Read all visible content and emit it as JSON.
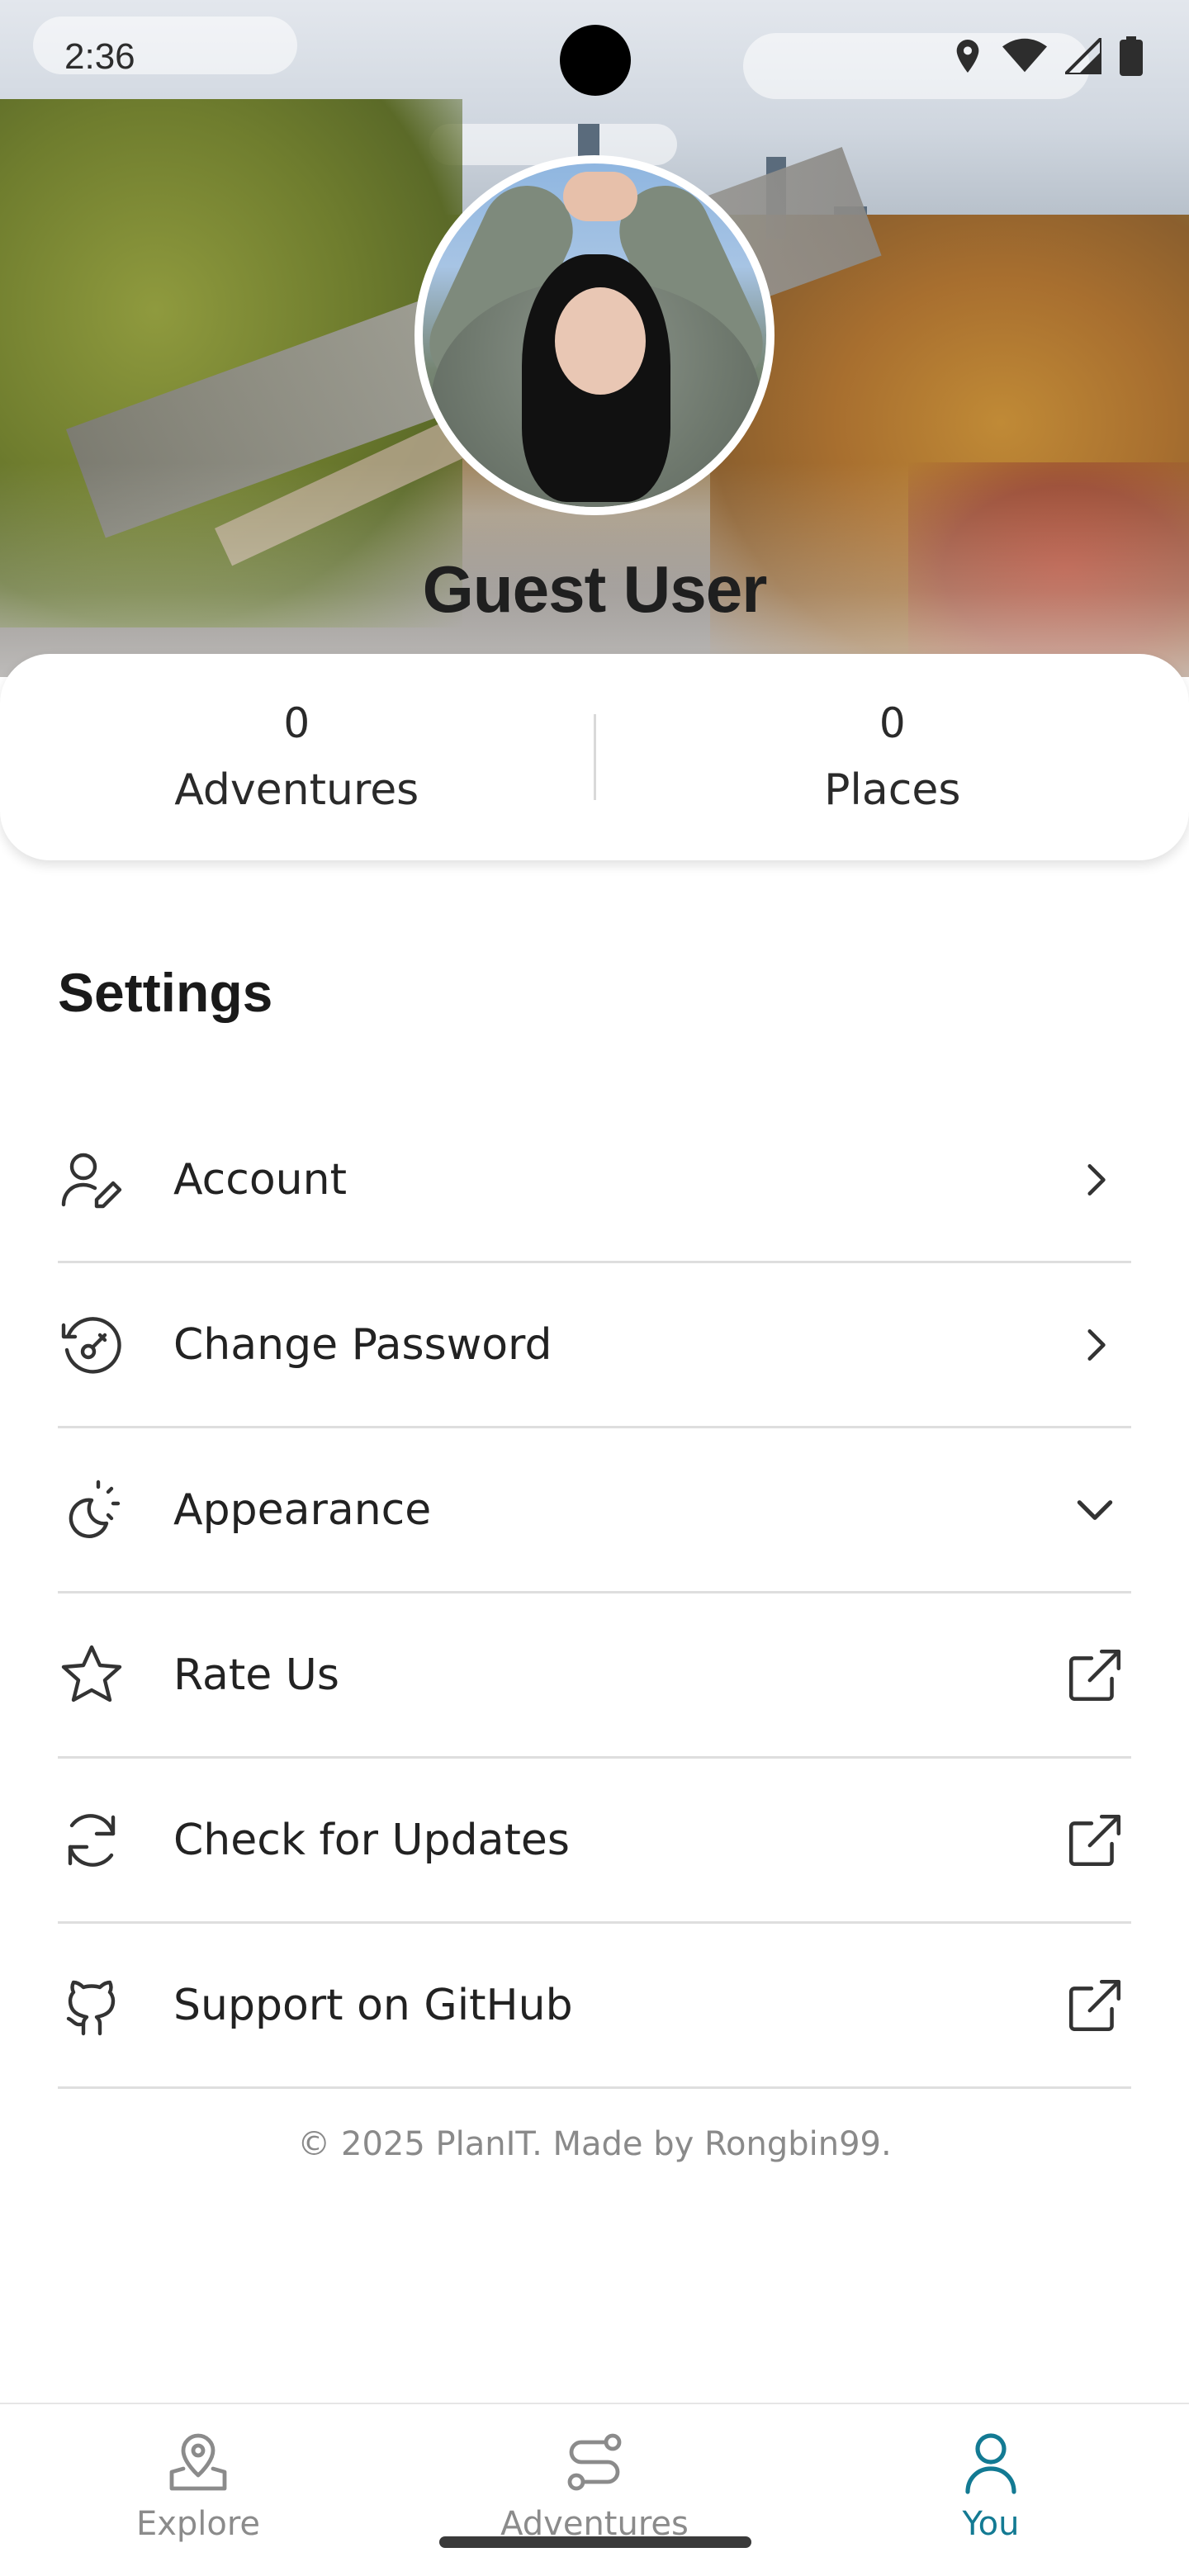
{
  "status_bar": {
    "time": "2:36",
    "icons": [
      "location-icon",
      "wifi-icon",
      "signal-icon",
      "battery-icon"
    ]
  },
  "profile": {
    "name": "Guest User",
    "avatar": "profile-photo"
  },
  "stats": [
    {
      "value": "0",
      "label": "Adventures"
    },
    {
      "value": "0",
      "label": "Places"
    }
  ],
  "settings": {
    "title": "Settings",
    "items": [
      {
        "label": "Account",
        "icon": "user-edit-icon",
        "trail": "chevron-right-icon"
      },
      {
        "label": "Change Password",
        "icon": "password-reset-icon",
        "trail": "chevron-right-icon"
      },
      {
        "label": "Appearance",
        "icon": "theme-icon",
        "trail": "chevron-down-icon"
      },
      {
        "label": "Rate Us",
        "icon": "star-icon",
        "trail": "external-link-icon"
      },
      {
        "label": "Check for Updates",
        "icon": "refresh-icon",
        "trail": "external-link-icon"
      },
      {
        "label": "Support on GitHub",
        "icon": "github-icon",
        "trail": "external-link-icon"
      }
    ]
  },
  "footer": {
    "copyright": "© 2025 PlanIT. Made by Rongbin99."
  },
  "bottom_nav": {
    "items": [
      {
        "label": "Explore",
        "icon": "map-pin-icon",
        "active": false
      },
      {
        "label": "Adventures",
        "icon": "route-icon",
        "active": false
      },
      {
        "label": "You",
        "icon": "person-icon",
        "active": true
      }
    ]
  },
  "colors": {
    "accent": "#137a93",
    "inactive": "#8b8b8b",
    "divider": "#dedede"
  }
}
